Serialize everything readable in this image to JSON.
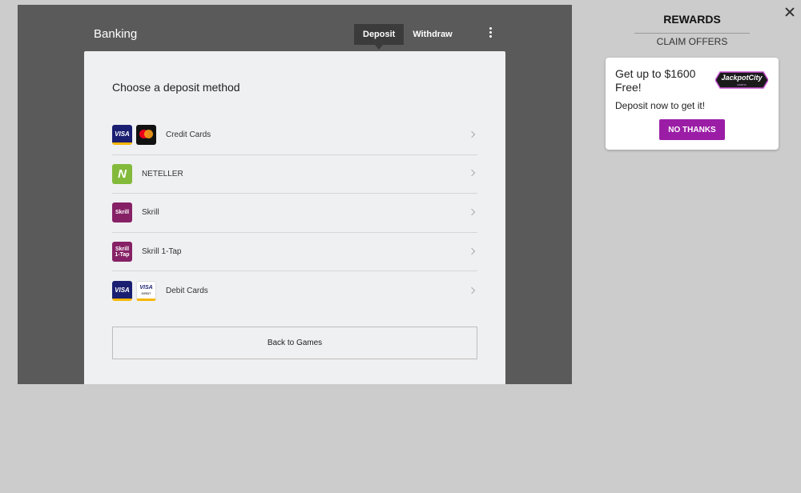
{
  "banking": {
    "title": "Banking",
    "tabs": [
      {
        "label": "Deposit",
        "active": true
      },
      {
        "label": "Withdraw",
        "active": false
      }
    ],
    "menu_icon": "kebab-menu-icon",
    "heading": "Choose a deposit method",
    "methods": [
      {
        "label": "Credit Cards",
        "icons": [
          "visa-icon",
          "mastercard-icon"
        ],
        "icon_text": [
          "VISA",
          ""
        ]
      },
      {
        "label": "NETELLER",
        "icons": [
          "neteller-icon"
        ],
        "icon_text": [
          "N"
        ]
      },
      {
        "label": "Skrill",
        "icons": [
          "skrill-icon"
        ],
        "icon_text": [
          "Skrill"
        ]
      },
      {
        "label": "Skrill 1-Tap",
        "icons": [
          "skrill-1tap-icon"
        ],
        "icon_text": [
          "Skrill",
          "1-Tap"
        ]
      },
      {
        "label": "Debit Cards",
        "icons": [
          "visa-icon",
          "visa-debit-icon"
        ],
        "icon_text": [
          "VISA",
          "VISA",
          "DEBIT"
        ]
      }
    ],
    "back_button": "Back to Games"
  },
  "rewards": {
    "title": "REWARDS",
    "subtitle": "CLAIM OFFERS",
    "offer": {
      "headline": "Get up to $1600 Free!",
      "logo_text": "JackpotCity",
      "logo_subtext": "casino",
      "description": "Deposit now to get it!",
      "button": "NO THANKS"
    }
  },
  "colors": {
    "backdrop": "#5a5a5a",
    "panel": "#eff0f2",
    "page": "#cccccc",
    "accent_purple": "#9b1da6",
    "active_tab": "#3b3b3b"
  },
  "close_icon": "close-icon"
}
